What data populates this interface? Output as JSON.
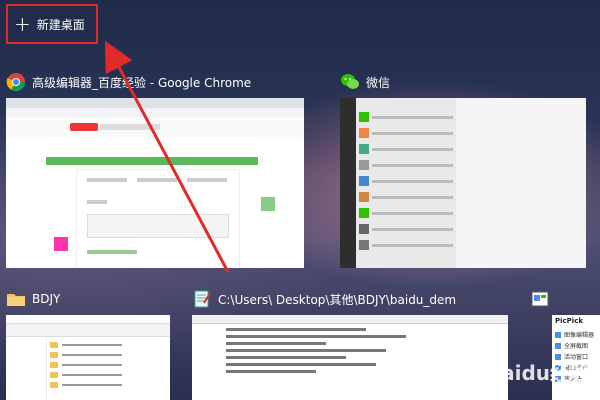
{
  "new_desktop": {
    "label": "新建桌面"
  },
  "windows": [
    {
      "title": "高级编辑器_百度经验 - Google Chrome",
      "icon": "chrome-icon"
    },
    {
      "title": "微信",
      "icon": "wechat-icon"
    },
    {
      "title": "BDJY",
      "icon": "folder-icon"
    },
    {
      "title": "C:\\Users\\    Desktop\\其他\\BDJY\\baidu_dem",
      "icon": "notepad-icon"
    },
    {
      "title": "",
      "icon": "picpick-icon"
    }
  ],
  "picpick": {
    "title": "PicPick",
    "items": [
      "图像编辑器",
      "全屏截图",
      "活动窗口",
      "窗口控件",
      "放大镜"
    ]
  },
  "watermark": "Baidu经验",
  "colors": {
    "highlight": "#e12a2a",
    "accent_green": "#5cb85c"
  }
}
